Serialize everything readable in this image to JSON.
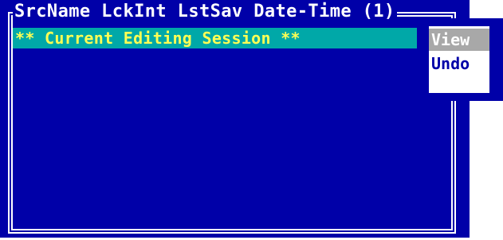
{
  "window": {
    "title": "SrcName LckInt LstSav Date-Time (1)"
  },
  "list": {
    "rows": [
      {
        "text": "** Current Editing Session **"
      }
    ]
  },
  "menu": {
    "items": [
      {
        "label": "View",
        "selected": true
      },
      {
        "label": "Undo",
        "selected": false
      }
    ]
  },
  "colors": {
    "background": "#0000a8",
    "border": "#ffffff",
    "highlight_row": "#00a8a8",
    "highlight_text": "#ffff54",
    "menu_selected": "#a8a8a8"
  }
}
